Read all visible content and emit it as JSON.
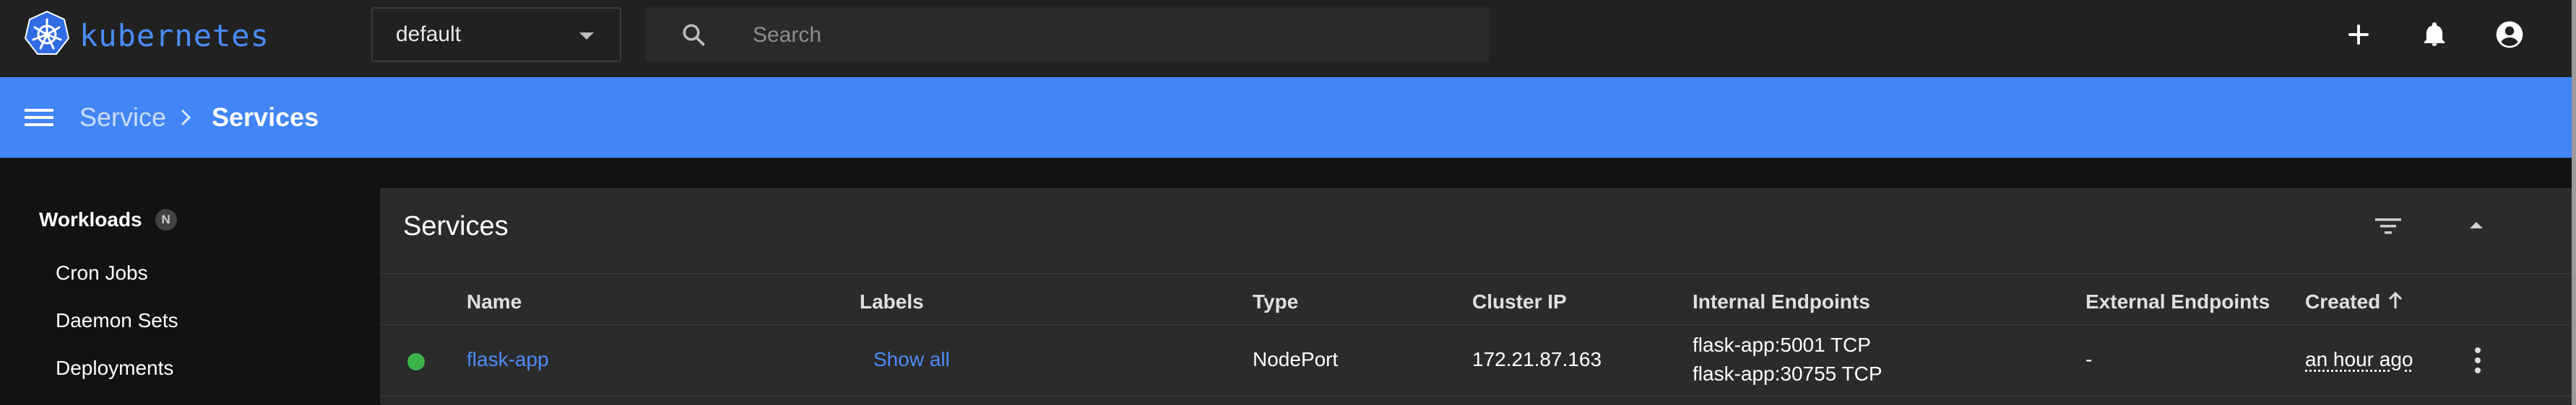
{
  "app": {
    "name": "kubernetes"
  },
  "namespace": {
    "selected": "default"
  },
  "search": {
    "placeholder": "Search"
  },
  "top_actions": {
    "create_icon": "plus-icon",
    "notifications_icon": "bell-icon",
    "account_icon": "account-circle-icon"
  },
  "breadcrumb": {
    "parent": "Service",
    "current": "Services"
  },
  "sidebar": {
    "section": {
      "label": "Workloads",
      "badge": "N"
    },
    "items": [
      {
        "label": "Cron Jobs"
      },
      {
        "label": "Daemon Sets"
      },
      {
        "label": "Deployments"
      }
    ]
  },
  "services_card": {
    "title": "Services",
    "columns": [
      "Name",
      "Labels",
      "Type",
      "Cluster IP",
      "Internal Endpoints",
      "External Endpoints",
      "Created"
    ],
    "sort": {
      "column": "Created",
      "direction": "ascending"
    },
    "rows": [
      {
        "status": "running",
        "status_color": "#3cb34a",
        "name": "flask-app",
        "labels": "Show all",
        "type": "NodePort",
        "cluster_ip": "172.21.87.163",
        "internal_endpoints": [
          "flask-app:5001 TCP",
          "flask-app:30755 TCP"
        ],
        "external_endpoints": "-",
        "created": "an hour ago"
      }
    ]
  },
  "colors": {
    "accent": "#4285f4",
    "link": "#4a8cf7",
    "topbar": "#212121",
    "background": "#121212",
    "card": "#2b2b2b"
  }
}
